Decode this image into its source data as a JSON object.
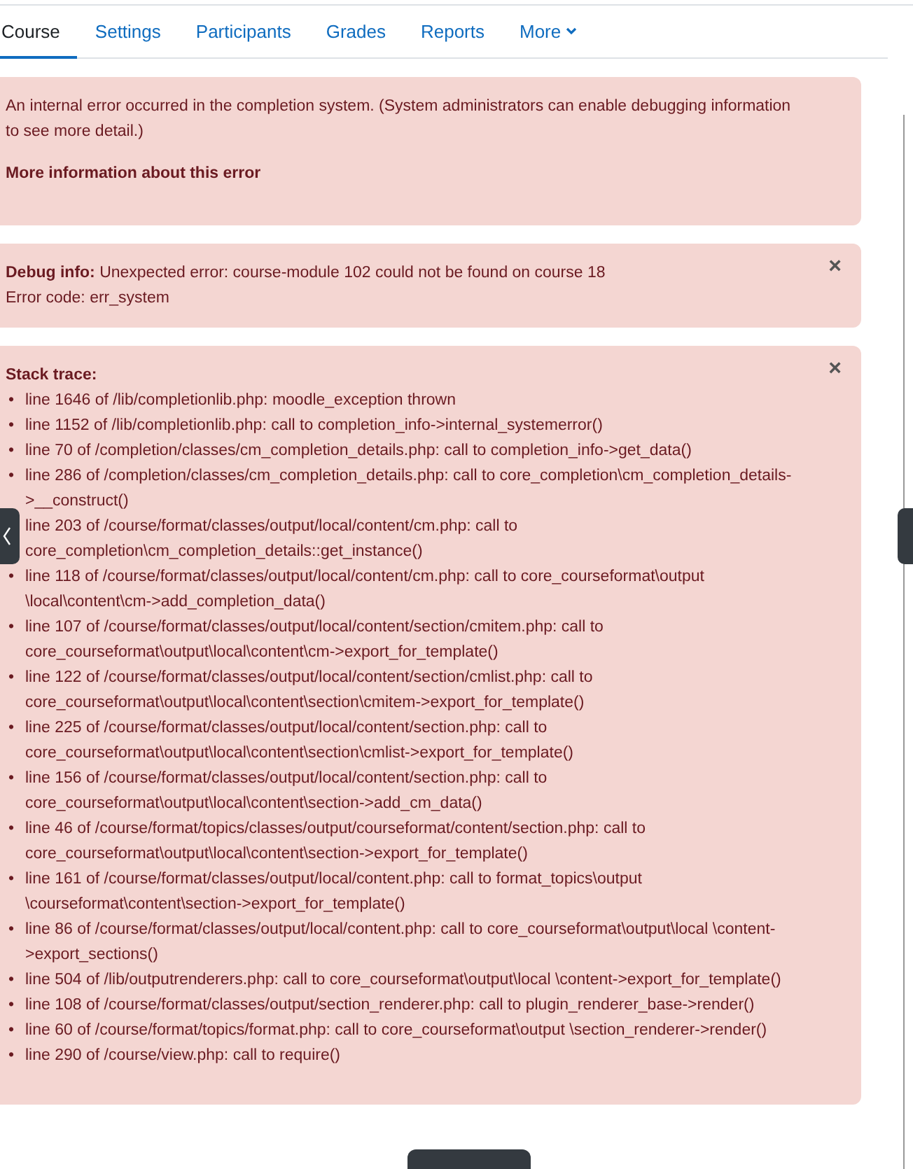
{
  "tabs": [
    {
      "label": "Course",
      "selected": true
    },
    {
      "label": "Settings",
      "selected": false
    },
    {
      "label": "Participants",
      "selected": false
    },
    {
      "label": "Grades",
      "selected": false
    },
    {
      "label": "Reports",
      "selected": false
    },
    {
      "label": "More",
      "selected": false,
      "dropdown": true
    }
  ],
  "error_alert": {
    "message": "An internal error occurred in the completion system. (System administrators can enable debugging information to see more detail.)",
    "more_info": "More information about this error"
  },
  "debug_alert": {
    "close": "×",
    "lines": [
      "**Debug info:** Unexpected error: course-module 102 could not be found on course 18",
      "Error code: err_system"
    ]
  },
  "stack_alert": {
    "close": "×",
    "title": "Stack trace:",
    "bullet": "•",
    "items": [
      "line 1646 of /lib/completionlib.php: moodle_exception thrown",
      "line 1152 of /lib/completionlib.php: call to completion_info->internal_systemerror()",
      "line 70 of /completion/classes/cm_completion_details.php: call to completion_info->get_data()",
      "line 286 of /completion/classes/cm_completion_details.php: call to core_completion\\cm_completion_details->__construct()",
      "line 203 of /course/format/classes/output/local/content/cm.php: call to core_completion\\cm_completion_details::get_instance()",
      "line 118 of /course/format/classes/output/local/content/cm.php: call to core_courseformat\\output \\local\\content\\cm->add_completion_data()",
      "line 107 of /course/format/classes/output/local/content/section/cmitem.php: call to core_courseformat\\output\\local\\content\\cm->export_for_template()",
      "line 122 of /course/format/classes/output/local/content/section/cmlist.php: call to core_courseformat\\output\\local\\content\\section\\cmitem->export_for_template()",
      "line 225 of /course/format/classes/output/local/content/section.php: call to core_courseformat\\output\\local\\content\\section\\cmlist->export_for_template()",
      "line 156 of /course/format/classes/output/local/content/section.php: call to core_courseformat\\output\\local\\content\\section->add_cm_data()",
      "line 46 of /course/format/topics/classes/output/courseformat/content/section.php: call to core_courseformat\\output\\local\\content\\section->export_for_template()",
      "line 161 of /course/format/classes/output/local/content.php: call to format_topics\\output \\courseformat\\content\\section->export_for_template()",
      "line 86 of /course/format/classes/output/local/content.php: call to core_courseformat\\output\\local \\content->export_sections()",
      "line 504 of /lib/outputrenderers.php: call to core_courseformat\\output\\local \\content->export_for_template()",
      "line 108 of /course/format/classes/output/section_renderer.php: call to plugin_renderer_base->render()",
      "line 60 of /course/format/topics/format.php: call to core_courseformat\\output \\section_renderer->render()",
      "line 290 of /course/view.php: call to require()"
    ]
  }
}
